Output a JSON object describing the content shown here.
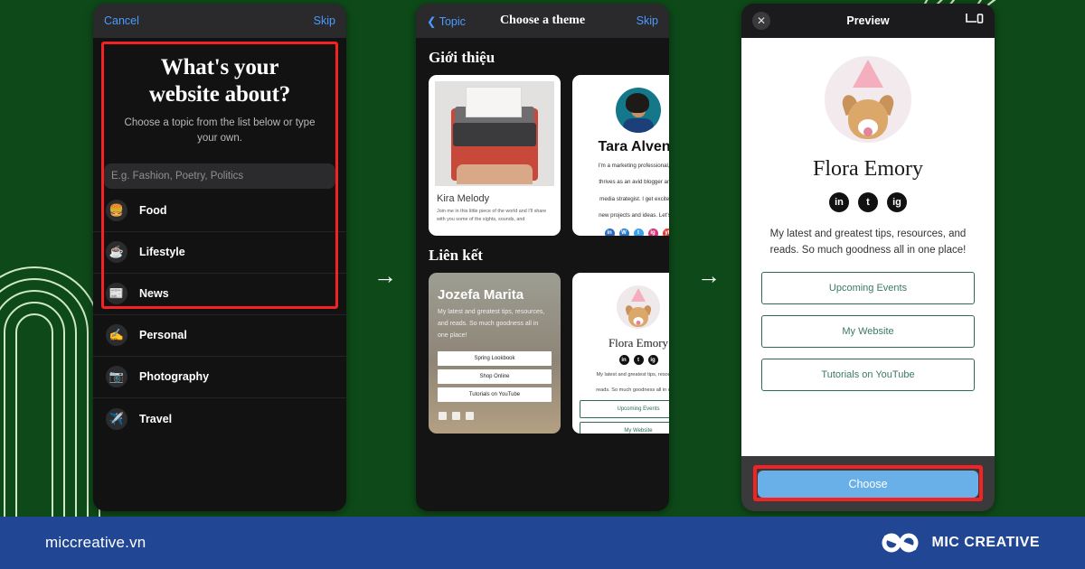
{
  "background": {
    "color": "#0e4a19",
    "accent_line_color": "#cfe8c6"
  },
  "arrows": {
    "glyph": "→",
    "between_1_2": "→",
    "between_2_3": "→"
  },
  "phone1": {
    "nav": {
      "left": "Cancel",
      "right": "Skip"
    },
    "heading_line1": "What's your",
    "heading_line2": "website about?",
    "subtitle": "Choose a topic from the list below or type your own.",
    "input_placeholder": "E.g. Fashion, Poetry, Politics",
    "input_value": "",
    "topics": [
      {
        "label": "Food",
        "icon": "🍔"
      },
      {
        "label": "Lifestyle",
        "icon": "☕"
      },
      {
        "label": "News",
        "icon": "📰"
      },
      {
        "label": "Personal",
        "icon": "✍️"
      },
      {
        "label": "Photography",
        "icon": "📷"
      },
      {
        "label": "Travel",
        "icon": "✈️"
      }
    ],
    "highlight_color": "#f42222"
  },
  "phone2": {
    "nav": {
      "back": "Topic",
      "title": "Choose a theme",
      "right": "Skip"
    },
    "sections": [
      {
        "title": "Giới thiệu",
        "cards": [
          {
            "name": "Kira Melody",
            "desc": "Join me in this little piece of the world and I'll share with you some of the sights, sounds, and"
          },
          {
            "name": "Tara Alvena",
            "desc_lines": [
              "I'm a marketing professional, wh",
              "thrives as an avid blogger and s",
              "media strategist. I get excited a",
              "new projects and ideas. Let's co"
            ],
            "socials": [
              "in",
              "W",
              "t",
              "ig",
              "yt"
            ],
            "social_colors": [
              "#2a6bbd",
              "#2b7cc9",
              "#38a1f3",
              "#d6337c",
              "#e03b2f"
            ]
          }
        ]
      },
      {
        "title": "Liên kết",
        "cards": [
          {
            "name": "Jozefa Marita",
            "desc": "My latest and greatest tips, resources, and reads. So much goodness all in one place!",
            "buttons": [
              "Spring Lookbook",
              "Shop Online",
              "Tutorials on YouTube"
            ],
            "socials": [
              "in",
              "t",
              "ig"
            ]
          },
          {
            "name": "Flora Emory",
            "desc_lines": [
              "My latest and greatest tips, resources",
              "reads. So much goodness all in one p"
            ],
            "socials": [
              "in",
              "t",
              "ig"
            ],
            "buttons": [
              "Upcoming Events",
              "My Website"
            ]
          }
        ]
      }
    ]
  },
  "phone3": {
    "nav": {
      "close": "✕",
      "title": "Preview",
      "device_icon": "device-toggle-icon"
    },
    "profile": {
      "name": "Flora Emory",
      "socials": [
        "in",
        "t",
        "ig"
      ],
      "bio": "My latest and greatest tips, resources, and reads. So much goodness all in one place!",
      "links": [
        "Upcoming Events",
        "My Website",
        "Tutorials on YouTube"
      ]
    },
    "choose_button": "Choose",
    "choose_button_color": "#69b0e8",
    "highlight_color": "#f42222"
  },
  "footer": {
    "url": "miccreative.vn",
    "brand": "MIC CREATIVE",
    "bar_color": "#214794"
  }
}
